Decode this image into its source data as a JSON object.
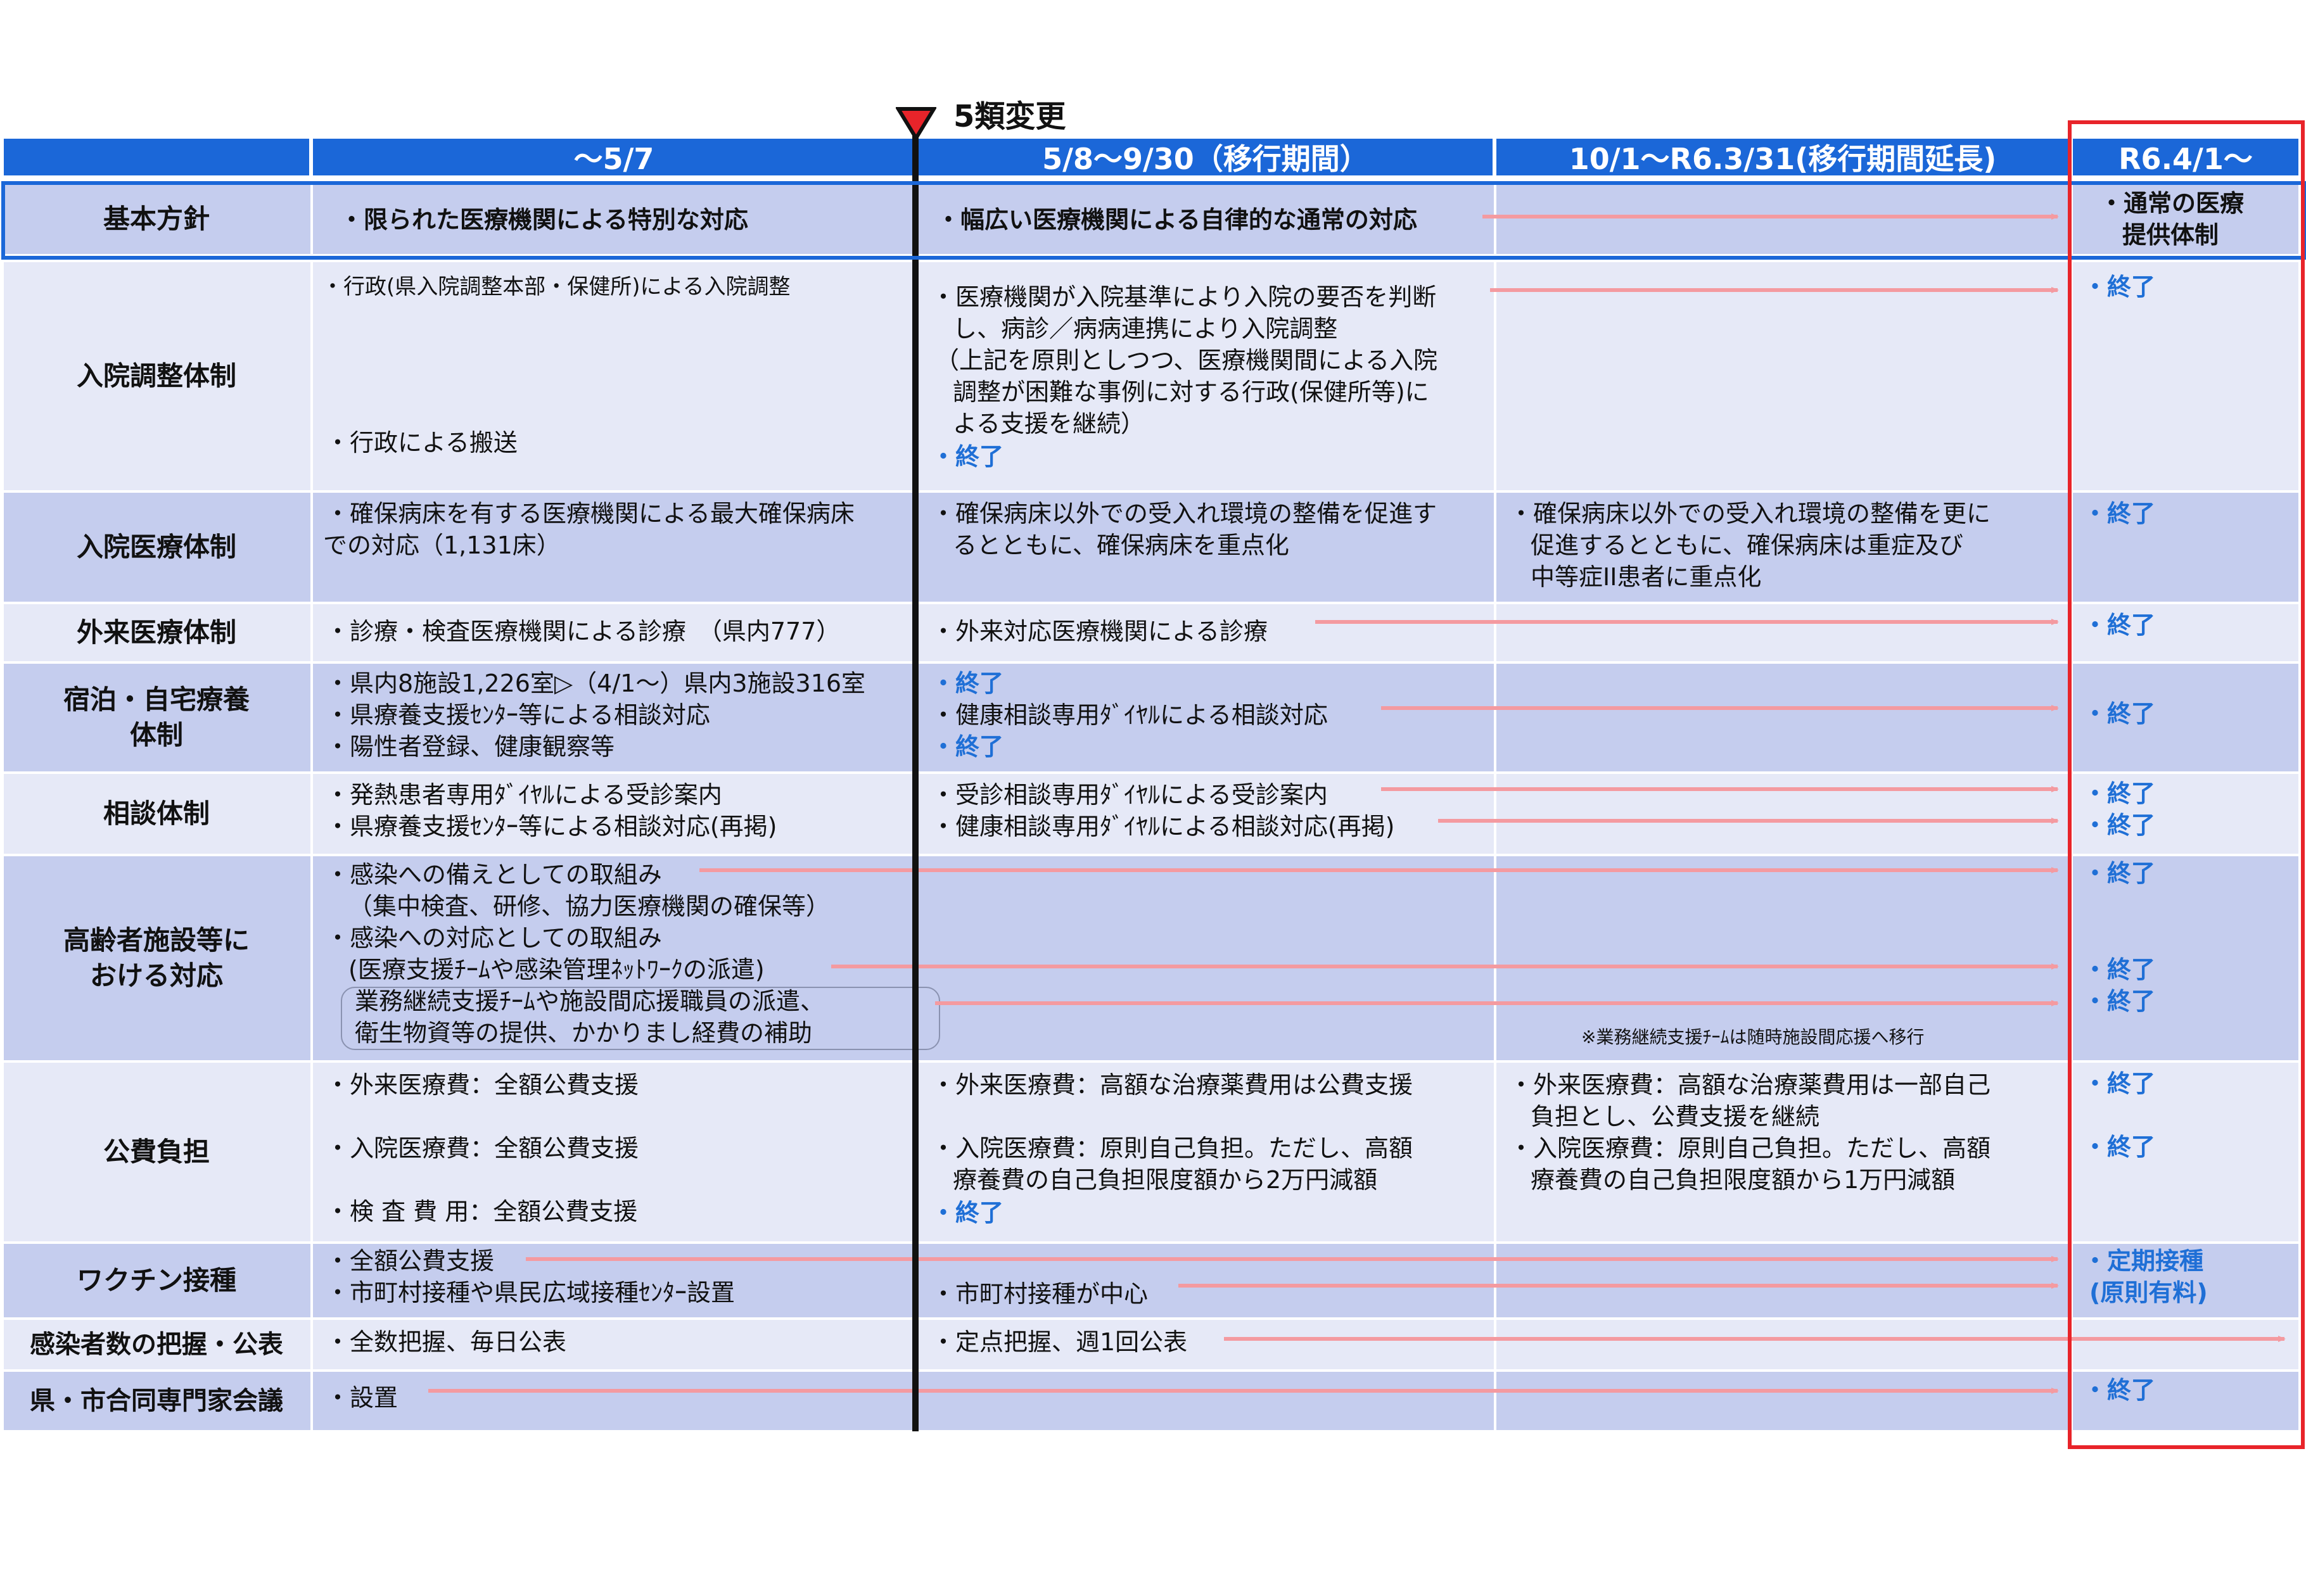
{
  "milestone": "5類変更",
  "columns": [
    "",
    "～5/7",
    "5/8～9/30（移行期間）",
    "10/1～R6.3/31(移行期間延長)",
    "R6.4/1～"
  ],
  "rows": {
    "basic": {
      "label": "基本方針",
      "c1": "・限られた医療機関による特別な対応",
      "c2": "・幅広い医療機関による自律的な通常の対応",
      "c4_1": "・通常の医療",
      "c4_2": "提供体制"
    },
    "admission": {
      "label": "入院調整体制",
      "c1_1": "・行政(県入院調整本部・保健所)による入院調整",
      "c1_2": "・行政による搬送",
      "c2_1": "・医療機関が入院基準により入院の要否を判断",
      "c2_2": "し、病診／病病連携により入院調整",
      "c2_3": "（上記を原則としつつ、医療機関間による入院",
      "c2_4": "調整が困難な事例に対する行政(保健所等)に",
      "c2_5": "よる支援を継続）",
      "c2_6": "・終了",
      "c4": "・終了"
    },
    "inpatient": {
      "label": "入院医療体制",
      "c1_1": "・確保病床を有する医療機関による最大確保病床",
      "c1_2": "での対応（1,131床）",
      "c2_1": "・確保病床以外での受入れ環境の整備を促進す",
      "c2_2": "るとともに、確保病床を重点化",
      "c3_1": "・確保病床以外での受入れ環境の整備を更に",
      "c3_2": "促進するとともに、確保病床は重症及び",
      "c3_3": "中等症II患者に重点化",
      "c4": "・終了"
    },
    "outpatient": {
      "label": "外来医療体制",
      "c1": "・診療・検査医療機関による診療　（県内777）",
      "c2": "・外来対応医療機関による診療",
      "c4": "・終了"
    },
    "lodging": {
      "label1": "宿泊・自宅療養",
      "label2": "体制",
      "c1_1": "・県内8施設1,226室▷（4/1～）県内3施設316室",
      "c1_2": "・県療養支援ｾﾝﾀｰ等による相談対応",
      "c1_3": "・陽性者登録、健康観察等",
      "c2_1": "・終了",
      "c2_2": "・健康相談専用ﾀﾞｲﾔﾙによる相談対応",
      "c2_3": "・終了",
      "c4": "・終了"
    },
    "consult": {
      "label": "相談体制",
      "c1_1": "・発熱患者専用ﾀﾞｲﾔﾙによる受診案内",
      "c1_2": "・県療養支援ｾﾝﾀｰ等による相談対応(再掲)",
      "c2_1": "・受診相談専用ﾀﾞｲﾔﾙによる受診案内",
      "c2_2": "・健康相談専用ﾀﾞｲﾔﾙによる相談対応(再掲)",
      "c4_1": "・終了",
      "c4_2": "・終了"
    },
    "elderly": {
      "label1": "高齢者施設等に",
      "label2": "おける対応",
      "c1_1": "・感染への備えとしての取組み",
      "c1_2": "（集中検査、研修、協力医療機関の確保等）",
      "c1_3": "・感染への対応としての取組み",
      "c1_4": "(医療支援ﾁｰﾑや感染管理ﾈｯﾄﾜｰｸの派遣)",
      "c1_5": "業務継続支援ﾁｰﾑや施設間応援職員の派遣、",
      "c1_6": "衛生物資等の提供、かかりまし経費の補助",
      "note": "※業務継続支援ﾁｰﾑは随時施設間応援へ移行",
      "c4_1": "・終了",
      "c4_2": "・終了",
      "c4_3": "・終了"
    },
    "cost": {
      "label": "公費負担",
      "c1_1": "・外来医療費：全額公費支援",
      "c1_2": "・入院医療費：全額公費支援",
      "c1_3": "・検 査 費 用：全額公費支援",
      "c2_1": "・外来医療費：高額な治療薬費用は公費支援",
      "c2_2": "・入院医療費：原則自己負担。ただし、高額",
      "c2_3": "療養費の自己負担限度額から2万円減額",
      "c2_4": "・終了",
      "c3_1": "・外来医療費：高額な治療薬費用は一部自己",
      "c3_2": "負担とし、公費支援を継続",
      "c3_3": "・入院医療費：原則自己負担。ただし、高額",
      "c3_4": "療養費の自己負担限度額から1万円減額",
      "c4_1": "・終了",
      "c4_2": "・終了"
    },
    "vaccine": {
      "label": "ワクチン接種",
      "c1_1": "・全額公費支援",
      "c1_2": "・市町村接種や県民広域接種ｾﾝﾀｰ設置",
      "c2": "・市町村接種が中心",
      "c4_1": "・定期接種",
      "c4_2": "(原則有料)"
    },
    "count": {
      "label": "感染者数の把握・公表",
      "c1": "・全数把握、毎日公表",
      "c2": "・定点把握、週1回公表"
    },
    "council": {
      "label": "県・市合同専門家会議",
      "c1": "・設置",
      "c4": "・終了"
    }
  },
  "colors": {
    "header_blue": "#1b67d8",
    "row_dark": "#c5cdee",
    "row_light": "#e6e9f7",
    "arrow_pink": "#f49aa0",
    "highlight_red": "#e8242a",
    "end_blue": "#1f6fd6"
  }
}
